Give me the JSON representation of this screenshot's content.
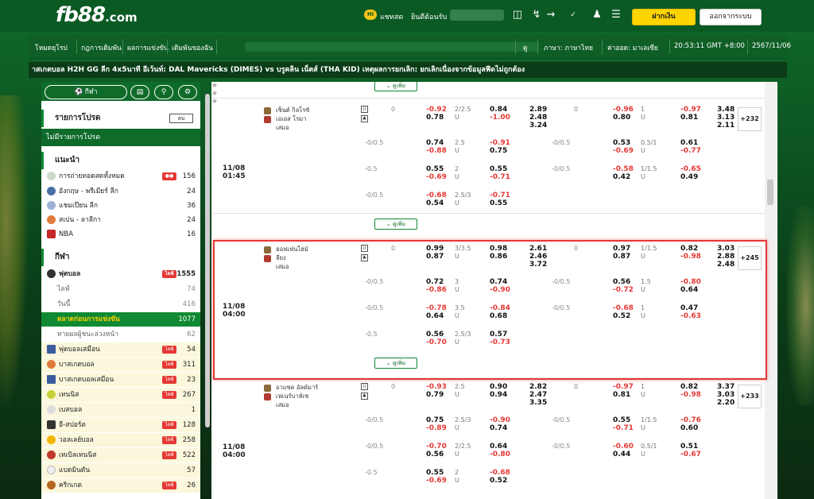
{
  "header": {
    "logo_main": "fb88",
    "logo_domain": ".com",
    "chat_label": "แชทสด",
    "welcome": "ยินดีต้อนรับ",
    "deposit": "ฝากเงิน",
    "logout": "ออกจากระบบ"
  },
  "nav": {
    "items": [
      "โหมดยุโรป",
      "กฎการเดิมพัน",
      "ผลการแข่งขัน",
      "เดิมพันของฉัน"
    ],
    "right": [
      "ดู",
      "ภาษา: ภาษาไทย",
      "ค่าออด: มาเลเซีย",
      "20:53:11 GMT +8:00",
      "2567/11/06"
    ]
  },
  "ticker": "าสเกตบอล H2H GG ลีก 4x5นาที อีเว้นท์: DAL Mavericks (DIMES) vs บรูคลิน เน็ตส์ (THA KID) เหตุผลการยกเลิก: ยกเลิกเนื่องจากข้อมูลฟีดไม่ถูกต้อง",
  "sidebar": {
    "sport_btn": "กีฬา",
    "promo_title": "รายการโปรด",
    "promo_btn": "ลบ",
    "promo_empty": "ไม่มีรายการโปรด",
    "rec_title": "แนะนำ",
    "rec": [
      {
        "label": "การถ่ายทอดสดทั้งหมด",
        "count": "156",
        "live": true
      },
      {
        "label": "อังกฤษ - พรีเมียร์ ลีก",
        "count": "24"
      },
      {
        "label": "แชมเปียน ลีก",
        "count": "36"
      },
      {
        "label": "สเปน - ลาลีกา",
        "count": "24"
      },
      {
        "label": "NBA",
        "count": "16"
      }
    ],
    "sport_title": "กีฬา",
    "football": {
      "label": "ฟุตบอล",
      "count": "1555",
      "live": "ไลฟ์"
    },
    "football_sub": [
      {
        "label": "ไลฟ์",
        "count": "74"
      },
      {
        "label": "วันนี้",
        "count": "416"
      },
      {
        "label": "ตลาดก่อนการแข่งขัน",
        "count": "1077"
      },
      {
        "label": "ทายผลผู้ชนะล่วงหน้า",
        "count": "62"
      }
    ],
    "sports": [
      {
        "label": "ฟุตบอลเสมือน",
        "count": "54",
        "live": "ไลฟ์"
      },
      {
        "label": "บาสเกตบอล",
        "count": "311",
        "live": "ไลฟ์"
      },
      {
        "label": "บาสเกตบอลเสมือน",
        "count": "23",
        "live": "ไลฟ์"
      },
      {
        "label": "เทนนิส",
        "count": "267",
        "live": "ไลฟ์"
      },
      {
        "label": "เบสบอล",
        "count": "1"
      },
      {
        "label": "อี-สปอร์ต",
        "count": "128",
        "live": "ไลฟ์"
      },
      {
        "label": "วอลเลย์บอล",
        "count": "258",
        "live": "ไลฟ์"
      },
      {
        "label": "เทเบิลเทนนิส",
        "count": "522",
        "live": "ไลฟ์"
      },
      {
        "label": "แบดมินตัน",
        "count": "57"
      },
      {
        "label": "คริกเกต",
        "count": "26",
        "live": "ไลฟ์"
      }
    ]
  },
  "main": {
    "more_label": "ดูเพิ่ม",
    "match1": {
      "home": "เซ็นต์ กิลโรซ์",
      "away": "เอเอส โรมา",
      "draw": "เสมอ",
      "date": "11/08",
      "time": "01:45",
      "plus": "+232"
    },
    "match2": {
      "home": "ฮอฟเฟ่นไฮม์",
      "away": "ลียง",
      "draw": "เสมอ",
      "date": "11/08",
      "time": "04:00",
      "plus": "+245"
    },
    "match3": {
      "home": "อาแซด อัลค์มาร์",
      "away": "เฟเนร์บาห์เช",
      "draw": "เสมอ",
      "date": "11/08",
      "time": "04:00",
      "plus": "+233"
    },
    "rows": [
      [
        "",
        "0",
        "-0.92",
        "2/2.5",
        "0.84",
        "2.89",
        "",
        "0",
        "-0.96",
        "1",
        "-0.97",
        "3.48"
      ],
      [
        "",
        "",
        "0.78",
        "U",
        "-1.00",
        "2.48",
        "",
        "",
        "0.80",
        "U",
        "0.81",
        "3.13"
      ],
      [
        "",
        "",
        "",
        "",
        "",
        "3.24",
        "",
        "",
        "",
        "",
        "",
        "2.11"
      ],
      [
        "-0/0.5",
        "",
        "0.74",
        "2.5",
        "-0.91",
        "",
        "-0/0.5",
        "",
        "0.53",
        "0.5/1",
        "0.61",
        ""
      ],
      [
        "",
        "",
        "-0.88",
        "U",
        "0.75",
        "",
        "",
        "",
        "-0.69",
        "U",
        "-0.77",
        ""
      ],
      [
        "-0.5",
        "",
        "0.55",
        "2",
        "0.55",
        "",
        "-0/0.5",
        "",
        "-0.58",
        "1/1.5",
        "-0.65",
        ""
      ],
      [
        "",
        "",
        "-0.69",
        "U",
        "-0.71",
        "",
        "",
        "",
        "0.42",
        "U",
        "0.49",
        ""
      ],
      [
        "-0/0.5",
        "",
        "-0.68",
        "2.5/3",
        "-0.71",
        "",
        "",
        "",
        "",
        "",
        "",
        ""
      ],
      [
        "",
        "",
        "0.54",
        "U",
        "0.55",
        "",
        "",
        "",
        "",
        "",
        "",
        ""
      ]
    ]
  },
  "colors": {
    "brand_green": "#0f6b2a",
    "accent_yellow": "#ffd400",
    "negative": "#e53935",
    "live_badge": "#e53935"
  }
}
